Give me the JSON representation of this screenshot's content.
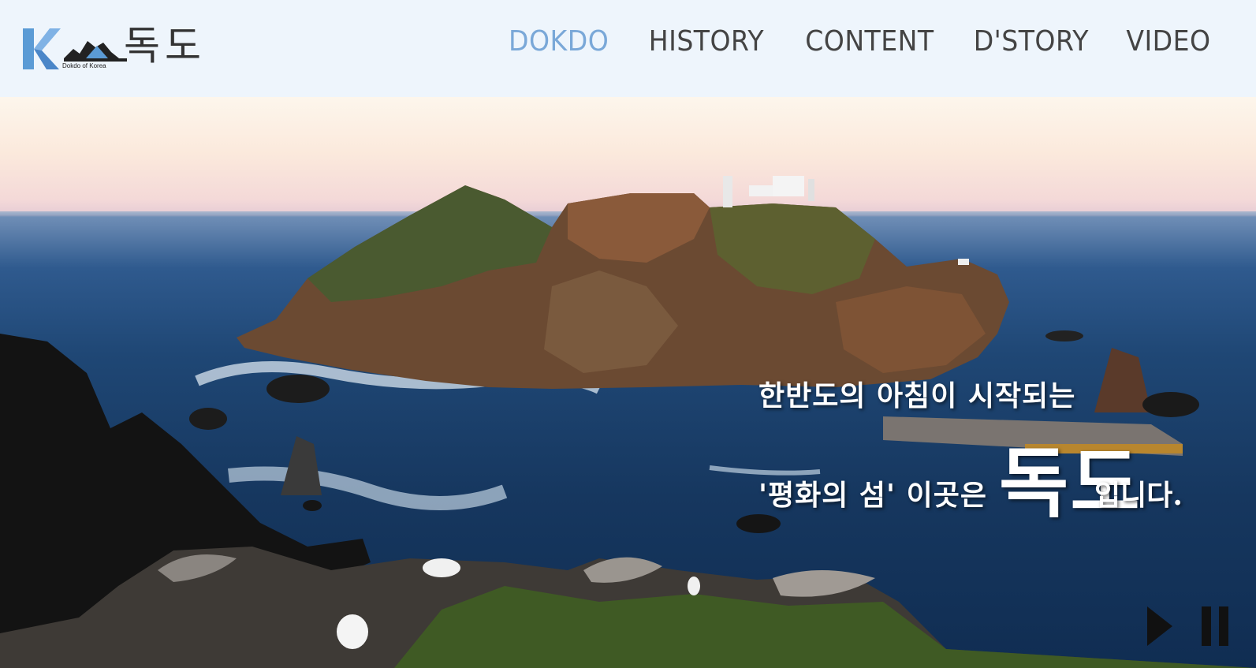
{
  "header": {
    "logo": {
      "letter": "K",
      "caption": "Dokdo of Korea",
      "hangul": "독도",
      "icons": [
        "k-logo-icon",
        "mountain-logo-icon"
      ]
    },
    "nav": [
      {
        "label": "DOKDO",
        "active": true
      },
      {
        "label": "HISTORY",
        "active": false
      },
      {
        "label": "CONTENT",
        "active": false
      },
      {
        "label": "D'STORY",
        "active": false
      },
      {
        "label": "VIDEO",
        "active": false
      }
    ]
  },
  "hero": {
    "slogan_line1": "한반도의 아침이 시작되는",
    "slogan_line2_prefix": "'평화의 섬' 이곳은",
    "slogan_highlight": "독도",
    "slogan_line2_suffix": "입니다.",
    "controls": {
      "play_icon": "play-icon",
      "pause_icon": "pause-icon"
    }
  },
  "colors": {
    "header_bg": "#eef5fc",
    "nav_active": "#7aa8d8",
    "nav_default": "#444444",
    "logo_blue": "#5b9bd5"
  }
}
